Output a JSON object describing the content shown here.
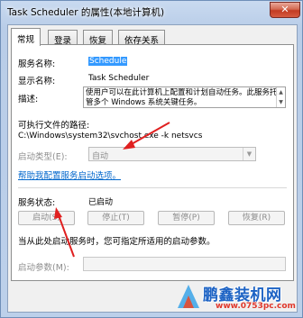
{
  "window": {
    "title": "Task Scheduler 的属性(本地计算机)",
    "close_label": "✕"
  },
  "tabs": [
    "常规",
    "登录",
    "恢复",
    "依存关系"
  ],
  "general": {
    "service_name_label": "服务名称:",
    "service_name_value": "Schedule",
    "display_name_label": "显示名称:",
    "display_name_value": "Task Scheduler",
    "description_label": "描述:",
    "description_value": "使用户可以在此计算机上配置和计划自动任务。此服务托管多个 Windows 系统关键任务。",
    "exe_path_label": "可执行文件的路径:",
    "exe_path_value": "C:\\Windows\\system32\\svchost.exe -k netsvcs",
    "startup_type_label": "启动类型(E):",
    "startup_type_value": "自动",
    "help_link": "帮助我配置服务启动选项。",
    "status_label": "服务状态:",
    "status_value": "已启动",
    "buttons": {
      "start": "启动(S)",
      "stop": "停止(T)",
      "pause": "暂停(P)",
      "resume": "恢复(R)"
    },
    "hint_text": "当从此处启动服务时，您可指定所适用的启动参数。",
    "start_params_label": "启动参数(M):",
    "start_params_value": ""
  },
  "watermark": {
    "text": "鹏鑫装机网",
    "url": "www.0753pc.com"
  },
  "colors": {
    "selection": "#3399ff",
    "link": "#0066cc",
    "arrow": "#e02020",
    "close_button": "#c23b22"
  }
}
